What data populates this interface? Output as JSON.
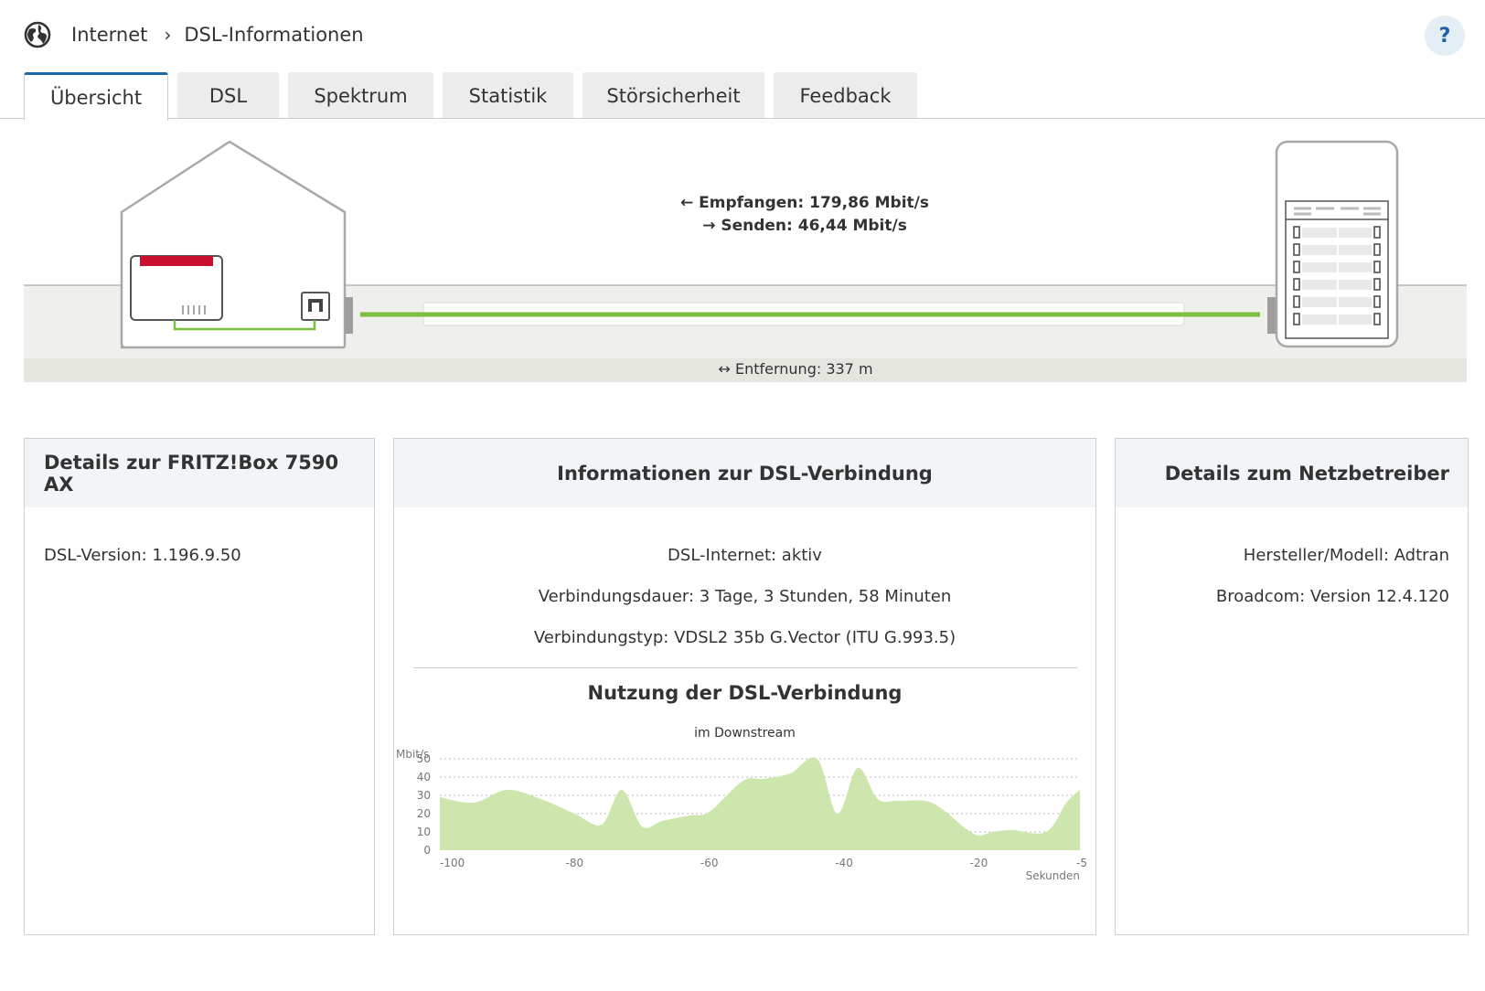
{
  "breadcrumb": {
    "section": "Internet",
    "page": "DSL-Informationen"
  },
  "help": {
    "label": "?"
  },
  "tabs": [
    {
      "label": "Übersicht",
      "active": true
    },
    {
      "label": "DSL",
      "active": false
    },
    {
      "label": "Spektrum",
      "active": false
    },
    {
      "label": "Statistik",
      "active": false
    },
    {
      "label": "Störsicherheit",
      "active": false
    },
    {
      "label": "Feedback",
      "active": false
    }
  ],
  "connection": {
    "receive_label": "Empfangen: 179,86 Mbit/s",
    "send_label": "Senden: 46,44 Mbit/s",
    "distance_label": "Entfernung: 337 m"
  },
  "panels": {
    "fritzbox": {
      "title": "Details zur FRITZ!Box 7590 AX",
      "dsl_version": "DSL-Version: 1.196.9.50"
    },
    "dsl": {
      "title": "Informationen zur DSL-Verbindung",
      "status": "DSL-Internet: aktiv",
      "duration": "Verbindungsdauer: 3 Tage, 3 Stunden, 58 Minuten",
      "type": "Verbindungstyp: VDSL2 35b G.Vector (ITU G.993.5)",
      "usage_title": "Nutzung der DSL-Verbindung",
      "usage_subtitle": "im Downstream"
    },
    "provider": {
      "title": "Details zum Netzbetreiber",
      "model": "Hersteller/Modell: Adtran",
      "broadcom": "Broadcom: Version 12.4.120"
    }
  },
  "colors": {
    "accent": "#1b6aa8",
    "line_green": "#7cbf3f",
    "chart_fill": "#cde6ad",
    "router_red": "#c8102e"
  },
  "chart_data": {
    "type": "area",
    "title": "Nutzung der DSL-Verbindung",
    "subtitle": "im Downstream",
    "xlabel": "Sekunden",
    "ylabel": "Mbit/s",
    "xlim": [
      -100,
      -5
    ],
    "ylim": [
      0,
      50
    ],
    "x_ticks": [
      -100,
      -80,
      -60,
      -40,
      -20,
      -5
    ],
    "y_ticks": [
      0,
      10,
      20,
      30,
      40,
      50
    ],
    "grid": true,
    "x": [
      -100,
      -95,
      -90,
      -85,
      -80,
      -76,
      -73,
      -70,
      -67,
      -63,
      -60,
      -55,
      -52,
      -48,
      -44,
      -41,
      -38,
      -35,
      -32,
      -27,
      -22,
      -20,
      -18,
      -15,
      -10,
      -7,
      -5
    ],
    "values": [
      29,
      26,
      33,
      28,
      20,
      14,
      33,
      13,
      16,
      19,
      21,
      38,
      39,
      42,
      50,
      20,
      45,
      28,
      27,
      26,
      12,
      8,
      10,
      11,
      10,
      26,
      33
    ]
  }
}
